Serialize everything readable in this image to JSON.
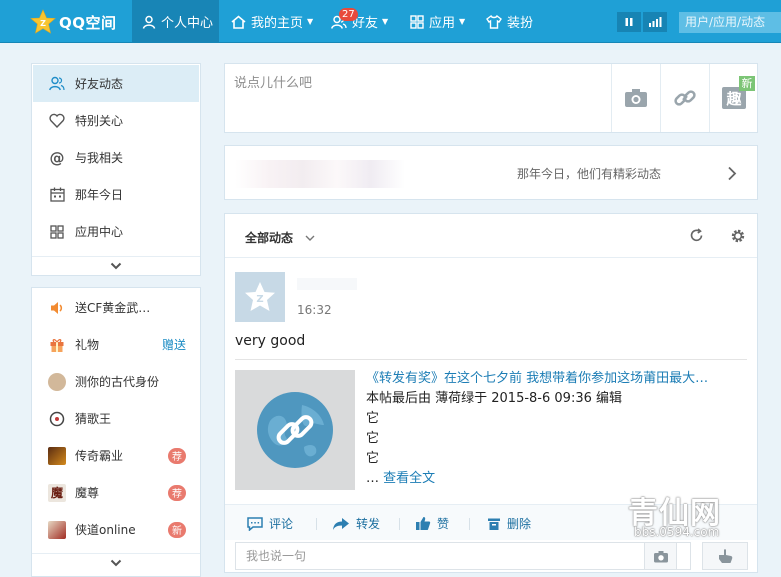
{
  "topbar": {
    "logo_text": "QQ空间",
    "nav": [
      {
        "label": "个人中心",
        "icon": "user-icon"
      },
      {
        "label": "我的主页",
        "icon": "home-icon"
      },
      {
        "label": "好友",
        "icon": "friends-icon",
        "badge": "27"
      },
      {
        "label": "应用",
        "icon": "apps-icon"
      },
      {
        "label": "装扮",
        "icon": "shirt-icon"
      }
    ],
    "search_placeholder": "用户/应用/动态"
  },
  "sidebar": {
    "items": [
      {
        "label": "好友动态",
        "icon": "friends-icon"
      },
      {
        "label": "特别关心",
        "icon": "heart-icon"
      },
      {
        "label": "与我相关",
        "icon": "at-icon"
      },
      {
        "label": "那年今日",
        "icon": "calendar-icon"
      },
      {
        "label": "应用中心",
        "icon": "grid-icon"
      }
    ],
    "apps": [
      {
        "label": "送CF黄金武…"
      },
      {
        "label": "礼物",
        "tag": "赠送"
      },
      {
        "label": "测你的古代身份"
      },
      {
        "label": "猜歌王"
      },
      {
        "label": "传奇霸业",
        "pill": "荐"
      },
      {
        "label": "魔尊",
        "pill": "荐"
      },
      {
        "label": "侠道online",
        "pill": "新"
      }
    ]
  },
  "composer": {
    "placeholder": "说点儿什么吧",
    "fun_label": "趣",
    "new_tag": "新"
  },
  "memory": {
    "text": "那年今日，他们有精彩动态"
  },
  "feed": {
    "filter_label": "全部动态",
    "post": {
      "time": "16:32",
      "text": "very good",
      "share_title": "《转发有奖》在这个七夕前 我想带着你参加这场莆田最大…",
      "share_line2": "本帖最后由 薄荷绿于 2015-8-6 09:36 编辑",
      "share_line3": "它",
      "share_line4": "它",
      "share_line5": "它",
      "more_prefix": "… ",
      "more_link": "查看全文"
    },
    "actions": {
      "comment": "评论",
      "forward": "转发",
      "like": "赞",
      "delete": "删除"
    },
    "reply_placeholder": "我也说一句"
  },
  "watermark": {
    "main": "青仙网",
    "sub": "bbs.0594.com"
  },
  "colors": {
    "topbar": "#1fa0d6",
    "accent": "#1c7db5"
  }
}
